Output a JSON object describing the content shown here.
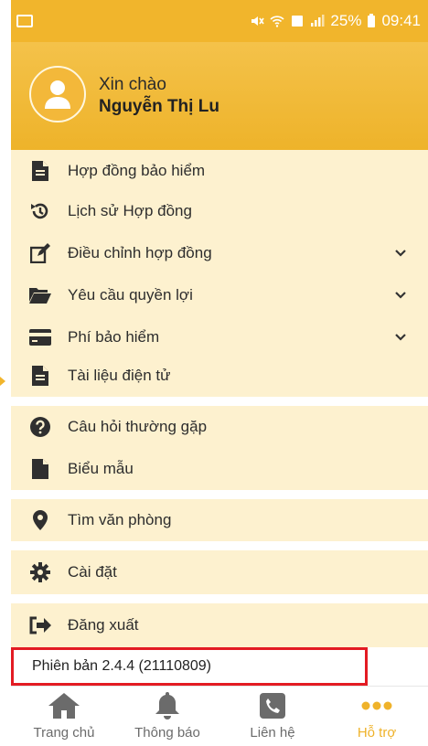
{
  "status_bar": {
    "battery": "25%",
    "time": "09:41"
  },
  "header": {
    "greeting": "Xin chào",
    "user_name": "Nguyễn Thị Lu"
  },
  "menu": {
    "group1": [
      {
        "label": "Hợp đồng bảo hiểm",
        "icon": "document-icon"
      },
      {
        "label": "Lịch sử Hợp đồng",
        "icon": "history-icon"
      },
      {
        "label": "Điều chỉnh hợp đồng",
        "icon": "edit-icon",
        "expandable": true
      },
      {
        "label": "Yêu cầu quyền lợi",
        "icon": "folder-open-icon",
        "expandable": true
      },
      {
        "label": "Phí bảo hiểm",
        "icon": "credit-card-icon",
        "expandable": true
      },
      {
        "label": "Tài liệu điện tử",
        "icon": "document-icon"
      }
    ],
    "group2": [
      {
        "label": "Câu hỏi thường gặp",
        "icon": "question-circle-icon"
      },
      {
        "label": "Biểu mẫu",
        "icon": "file-icon"
      }
    ],
    "group3": [
      {
        "label": "Tìm văn phòng",
        "icon": "map-pin-icon"
      }
    ],
    "group4": [
      {
        "label": "Cài đặt",
        "icon": "gear-icon"
      }
    ],
    "group5": [
      {
        "label": "Đăng xuất",
        "icon": "sign-out-icon"
      }
    ]
  },
  "version": "Phiên bản 2.4.4 (21110809)",
  "bottom_nav": [
    {
      "label": "Trang chủ",
      "icon": "home-icon"
    },
    {
      "label": "Thông báo",
      "icon": "bell-icon"
    },
    {
      "label": "Liên hệ",
      "icon": "phone-icon"
    },
    {
      "label": "Hỗ trợ",
      "icon": "more-dots-icon",
      "active": true
    }
  ],
  "colors": {
    "accent": "#f1b52c",
    "menu_bg": "#fdf1cf",
    "icon": "#2f2f2f",
    "highlight_border": "#e31b23"
  }
}
